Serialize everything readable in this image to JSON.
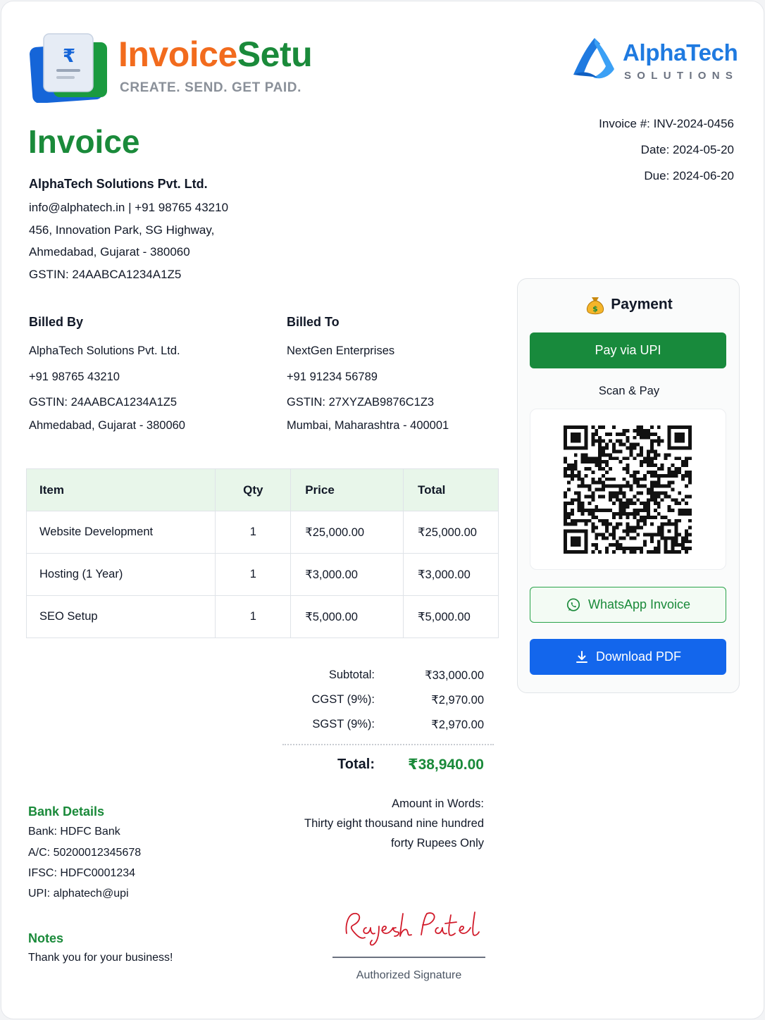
{
  "brand": {
    "name_part1": "Invoice",
    "name_part2": "Setu",
    "tagline": "CREATE. SEND. GET PAID.",
    "logo_symbol": "₹"
  },
  "client_brand": {
    "name": "AlphaTech",
    "subtitle": "SOLUTIONS"
  },
  "invoice": {
    "title": "Invoice",
    "number": "Invoice #: INV-2024-0456",
    "date": "Date: 2024-05-20",
    "due": "Due: 2024-06-20"
  },
  "company": {
    "name": "AlphaTech Solutions Pvt. Ltd.",
    "contact": "info@alphatech.in  |  +91 98765 43210",
    "address1": "456, Innovation Park, SG Highway,",
    "address2": "Ahmedabad, Gujarat - 380060",
    "gstin": "GSTIN: 24AABCA1234A1Z5"
  },
  "billed_by": {
    "heading": "Billed By",
    "name": "AlphaTech Solutions Pvt. Ltd.",
    "phone": "+91 98765 43210",
    "gstin": "GSTIN: 24AABCA1234A1Z5",
    "location": "Ahmedabad, Gujarat - 380060"
  },
  "billed_to": {
    "heading": "Billed To",
    "name": "NextGen Enterprises",
    "phone": "+91 91234 56789",
    "gstin": "GSTIN: 27XYZAB9876C1Z3",
    "location": "Mumbai, Maharashtra - 400001"
  },
  "table": {
    "headers": [
      "Item",
      "Qty",
      "Price",
      "Total"
    ],
    "rows": [
      [
        "Website Development",
        "1",
        "₹25,000.00",
        "₹25,000.00"
      ],
      [
        "Hosting (1 Year)",
        "1",
        "₹3,000.00",
        "₹3,000.00"
      ],
      [
        "SEO Setup",
        "1",
        "₹5,000.00",
        "₹5,000.00"
      ]
    ]
  },
  "totals": {
    "subtotal_label": "Subtotal:",
    "subtotal": "₹33,000.00",
    "cgst_label": "CGST (9%):",
    "cgst": "₹2,970.00",
    "sgst_label": "SGST (9%):",
    "sgst": "₹2,970.00",
    "total_label": "Total:",
    "total": "₹38,940.00",
    "words_label": "Amount in Words:",
    "words_line1": "Thirty eight thousand nine hundred",
    "words_line2": "forty Rupees Only"
  },
  "bank": {
    "heading": "Bank Details",
    "bank": "Bank: HDFC Bank",
    "account": "A/C: 50200012345678",
    "ifsc": "IFSC: HDFC0001234",
    "upi": "UPI: alphatech@upi"
  },
  "notes": {
    "heading": "Notes",
    "text": "Thank you for your business!"
  },
  "signature": {
    "name": "Rajesh Patel",
    "label": "Authorized Signature"
  },
  "payment": {
    "heading": "Payment",
    "pay_upi": "Pay via UPI",
    "scan": "Scan & Pay",
    "whatsapp": "WhatsApp Invoice",
    "download": "Download PDF",
    "icons": {
      "bag": "money-bag-icon",
      "whatsapp": "whatsapp-icon",
      "download": "download-icon",
      "qr": "qr-code"
    }
  },
  "colors": {
    "brand_orange": "#f26b1d",
    "brand_green": "#1a8a3a",
    "upi_button": "#188a3c",
    "pdf_button": "#1366ec",
    "alpha_blue": "#1f7ae0",
    "table_header_bg": "#e8f6ea",
    "signature_red": "#d11a2a"
  }
}
